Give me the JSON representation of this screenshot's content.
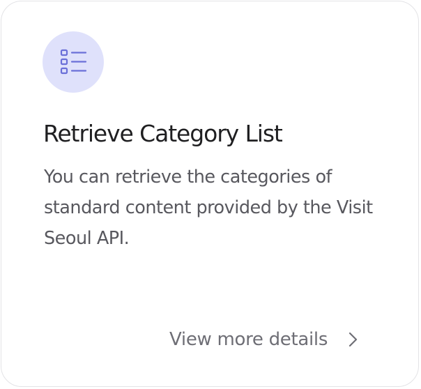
{
  "card": {
    "icon": "list-icon",
    "title": "Retrieve Category List",
    "description": "You can retrieve the categories of standard content provided by the Visit Seoul API.",
    "more_link_label": "View more details",
    "more_link_icon": "chevron-right-icon"
  },
  "colors": {
    "icon_background": "#dfe1fb",
    "icon_stroke": "#6a6fd8",
    "title": "#1f1f21",
    "description": "#58585e",
    "link": "#6e6e75",
    "border": "#e3e3e6"
  }
}
